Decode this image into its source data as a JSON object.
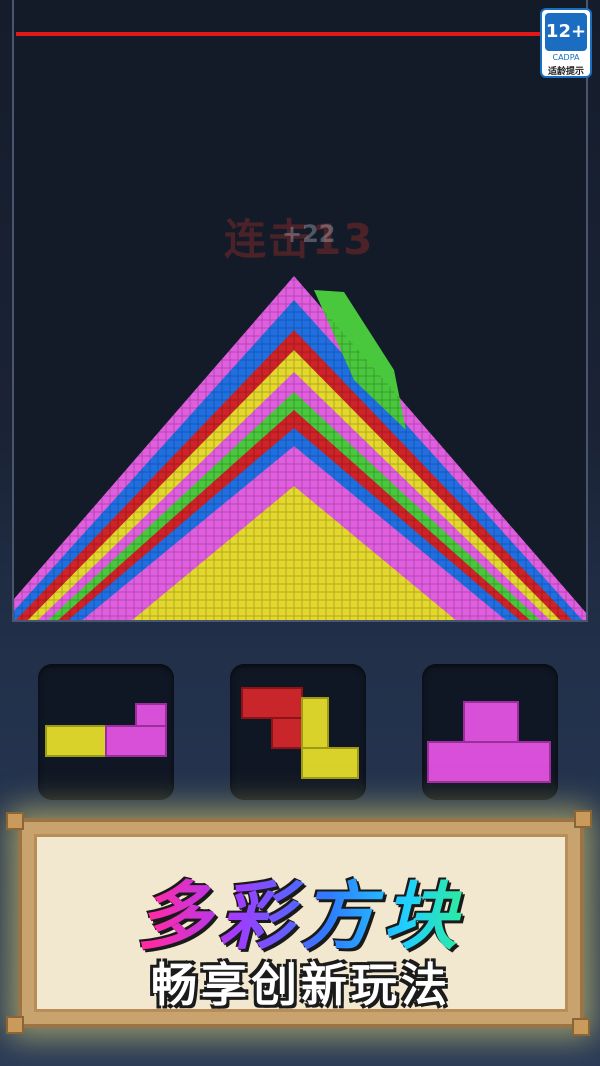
{
  "game": {
    "combo_text": "连击13",
    "score_popup": "+22"
  },
  "age_rating": {
    "rating": "12+",
    "org": "CADPA",
    "tip": "适龄提示"
  },
  "pieces": [
    {
      "name": "piece-L-yellow-pink",
      "colors": [
        "#d8d22a",
        "#d84fd8"
      ]
    },
    {
      "name": "piece-Z-red-yellow",
      "colors": [
        "#c8262a",
        "#d8d22a"
      ]
    },
    {
      "name": "piece-T-pink",
      "colors": [
        "#d84fd8"
      ]
    }
  ],
  "banner": {
    "title": "多彩方块",
    "subtitle": "畅享创新玩法"
  },
  "colors": {
    "pink": "#e15ee0",
    "green": "#49c83d",
    "red": "#cf2328",
    "yellow": "#e4d82c",
    "blue": "#1f6fe3",
    "limit_line": "#e01818"
  }
}
